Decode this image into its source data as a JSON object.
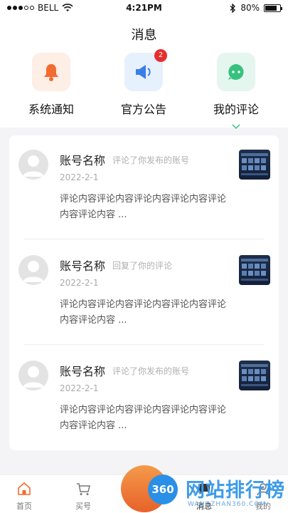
{
  "status_bar": {
    "carrier": "BELL",
    "time": "4:21PM",
    "battery_label": "80%",
    "battery_level": 0.8
  },
  "page_title": "消息",
  "categories": [
    {
      "label": "系统通知",
      "icon": "bell-icon",
      "bg": "#fdeee6",
      "color": "#f26b2f"
    },
    {
      "label": "官方公告",
      "icon": "speaker-icon",
      "bg": "#e7f0fd",
      "color": "#3a7ee8",
      "badge": "2"
    },
    {
      "label": "我的评论",
      "icon": "comment-icon",
      "bg": "#e4f6ee",
      "color": "#34c27e"
    }
  ],
  "messages": [
    {
      "account": "账号名称",
      "action": "评论了你发布的账号",
      "date": "2022-2-1",
      "content": "评论内容评论内容评论内容评论内容评论内容评论内容 ..."
    },
    {
      "account": "账号名称",
      "action": "回复了你的评论",
      "date": "2022-2-1",
      "content": "评论内容评论内容评论内容评论内容评论内容评论内容 ..."
    },
    {
      "account": "账号名称",
      "action": "评论了你发布的账号",
      "date": "2022-2-1",
      "content": "评论内容评论内容评论内容评论内容评论内容评论内容 ..."
    }
  ],
  "tabbar": [
    {
      "label": "首页",
      "icon": "home-icon"
    },
    {
      "label": "买号",
      "icon": "cart-icon"
    },
    {
      "label": "消息",
      "icon": "message-icon"
    },
    {
      "label": "我的",
      "icon": "profile-icon"
    }
  ],
  "watermark": {
    "logo": "360",
    "text": "网站排行榜",
    "sub": "WANGZHAN360.COM"
  },
  "colors": {
    "accent": "#f26b2f",
    "badge": "#e62e2e",
    "page_bg": "#f4f4f6"
  }
}
